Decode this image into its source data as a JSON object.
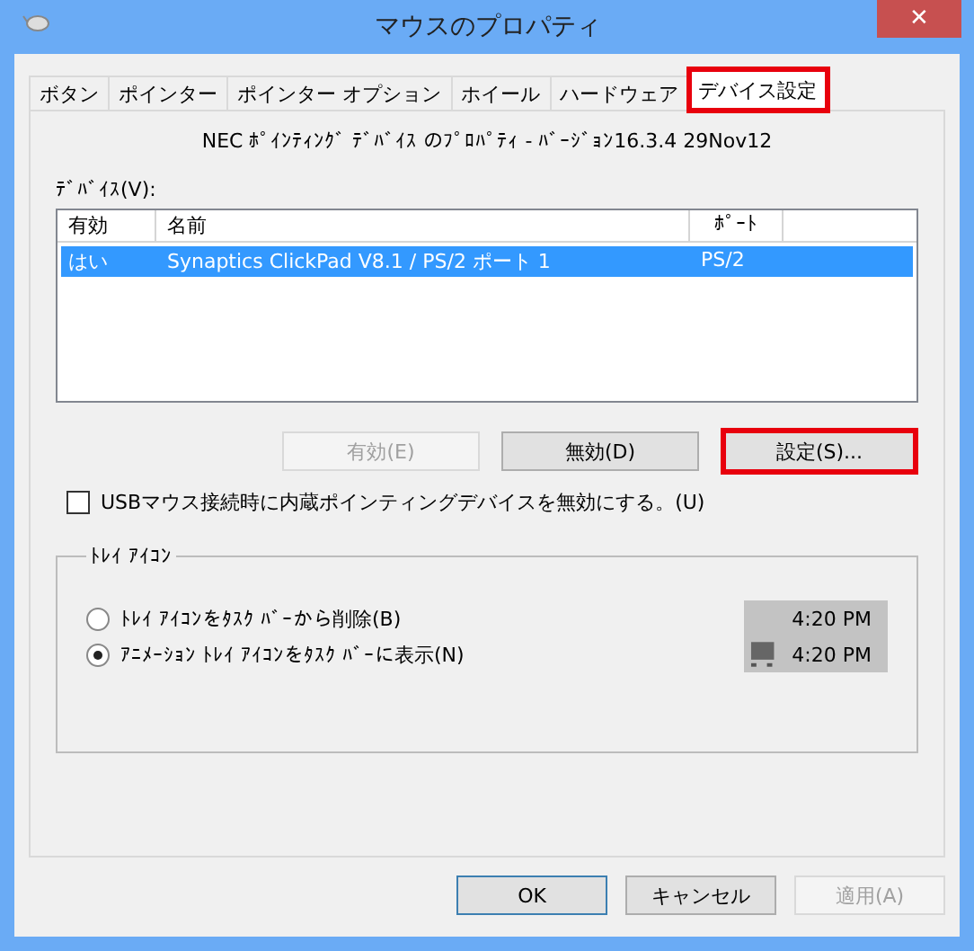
{
  "window": {
    "title": "マウスのプロパティ",
    "close": "✕"
  },
  "tabs": [
    {
      "label": "ボタン",
      "selected": false,
      "highlighted": false
    },
    {
      "label": "ポインター",
      "selected": false,
      "highlighted": false
    },
    {
      "label": "ポインター オプション",
      "selected": false,
      "highlighted": false
    },
    {
      "label": "ホイール",
      "selected": false,
      "highlighted": false
    },
    {
      "label": "ハードウェア",
      "selected": false,
      "highlighted": false
    },
    {
      "label": "デバイス設定",
      "selected": true,
      "highlighted": true
    }
  ],
  "version": "NEC ﾎﾟｲﾝﾃｨﾝｸﾞ ﾃﾞﾊﾞｲｽ のﾌﾟﾛﾊﾟﾃｨ - ﾊﾞｰｼﾞｮﾝ16.3.4 29Nov12",
  "devices": {
    "label": "ﾃﾞﾊﾞｲｽ(V):",
    "columns": [
      "有効",
      "名前",
      "ﾎﾟｰﾄ"
    ],
    "rows": [
      {
        "cells": [
          "はい",
          "Synaptics ClickPad V8.1 / PS/2 ポート 1",
          "PS/2"
        ],
        "selected": true
      }
    ]
  },
  "device_buttons": [
    {
      "label": "有効(E)",
      "disabled": true,
      "highlighted": false
    },
    {
      "label": "無効(D)",
      "disabled": false,
      "highlighted": false
    },
    {
      "label": "設定(S)...",
      "disabled": false,
      "highlighted": true
    }
  ],
  "usb_option": {
    "label": "USBマウス接続時に内蔵ポインティングデバイスを無効にする。(U)",
    "checked": false
  },
  "tray": {
    "title": "ﾄﾚｲ ｱｲｺﾝ",
    "options": [
      {
        "label": "ﾄﾚｲ ｱｲｺﾝをﾀｽｸ ﾊﾞｰから削除(B)",
        "selected": false,
        "preview_time": "4:20 PM",
        "preview_icon": false
      },
      {
        "label": "ｱﾆﾒｰｼｮﾝ ﾄﾚｲ ｱｲｺﾝをﾀｽｸ ﾊﾞｰに表示(N)",
        "selected": true,
        "preview_time": "4:20 PM",
        "preview_icon": true
      }
    ]
  },
  "buttons": [
    {
      "label": "OK",
      "default": true,
      "disabled": false
    },
    {
      "label": "キャンセル",
      "default": false,
      "disabled": false
    },
    {
      "label": "適用(A)",
      "default": false,
      "disabled": true
    }
  ]
}
